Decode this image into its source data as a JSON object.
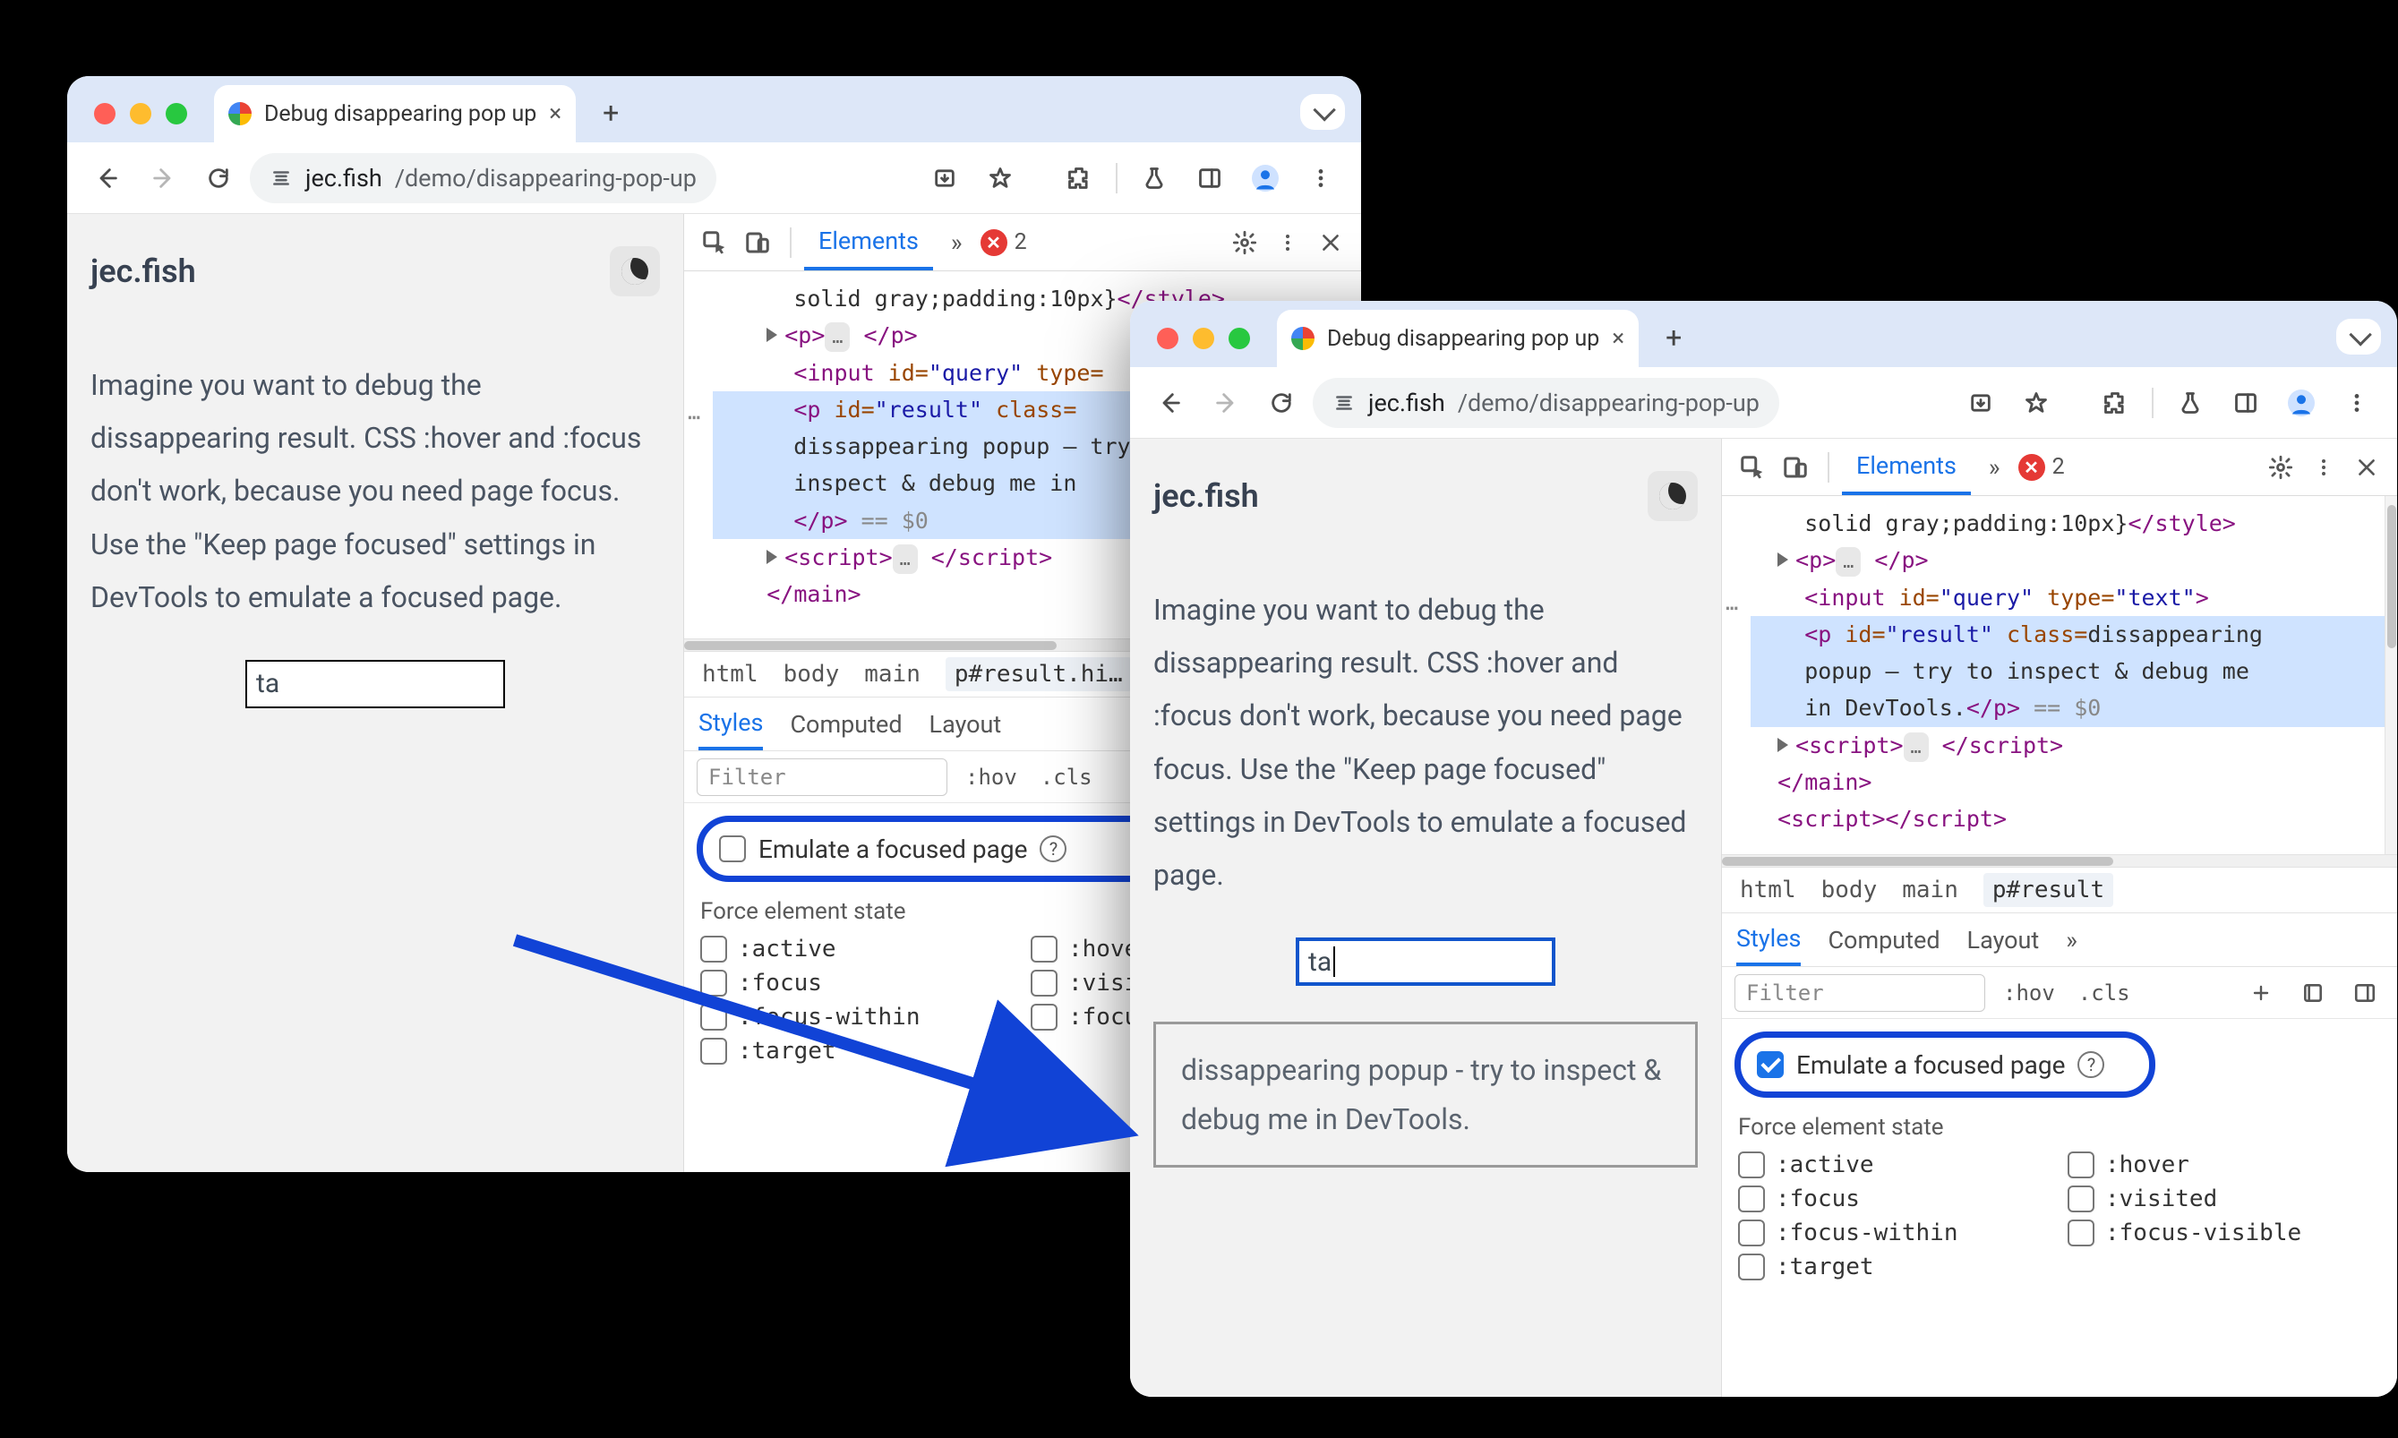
{
  "tab": {
    "title": "Debug disappearing pop up"
  },
  "url": {
    "host": "jec.fish",
    "path": "/demo/disappearing-pop-up"
  },
  "page": {
    "site_title": "jec.fish",
    "paragraph": "Imagine you want to debug the dissappearing result. CSS :hover and :focus don't work, because you need page focus. Use the \"Keep page focused\" settings in DevTools to emulate a focused page.",
    "query_value": "ta",
    "popup_text": "dissappearing popup - try to inspect & debug me in DevTools."
  },
  "devtools": {
    "tabs": {
      "elements": "Elements",
      "more": "»",
      "errors": "2"
    },
    "dom": {
      "style_frag": "solid gray;padding:10px}",
      "p_open": "<p>",
      "p_close": "</p>",
      "input": {
        "tag_open": "<input ",
        "id_attr": "id=",
        "id_val": "\"query\"",
        "type_attr": " type=",
        "type_val": "\"text\"",
        "close": ">"
      },
      "result": {
        "open": "<p ",
        "id_attr": "id=",
        "id_val": "\"result\"",
        "class_attr": " class=",
        "text_a": "dissappearing popup - try to inspect & debug me in DevTools.",
        "close": "</p>",
        "eq0": " == $0"
      },
      "script": {
        "open": "<script>",
        "close": "</script>"
      },
      "main_close": "</main>",
      "style_close": "</style>"
    },
    "crumbs": {
      "html": "html",
      "body": "body",
      "main": "main",
      "resultA": "p#result.hi…",
      "resultB": "p#result"
    },
    "subtabs": {
      "styles": "Styles",
      "computed": "Computed",
      "layout": "Layout",
      "more": "»"
    },
    "stylebar": {
      "filter_ph": "Filter",
      "hov": ":hov",
      "cls": ".cls"
    },
    "emulate_label": "Emulate a focused page",
    "force_state": {
      "title": "Force element state",
      "active": ":active",
      "hover": ":hover",
      "focus": ":focus",
      "visited": ":visited",
      "focus_within": ":focus-within",
      "focus_visible": ":focus-visible",
      "target": ":target",
      "hover_cut": ":hove",
      "visi_cut": ":visi",
      "focu_cut": ":focu"
    }
  }
}
